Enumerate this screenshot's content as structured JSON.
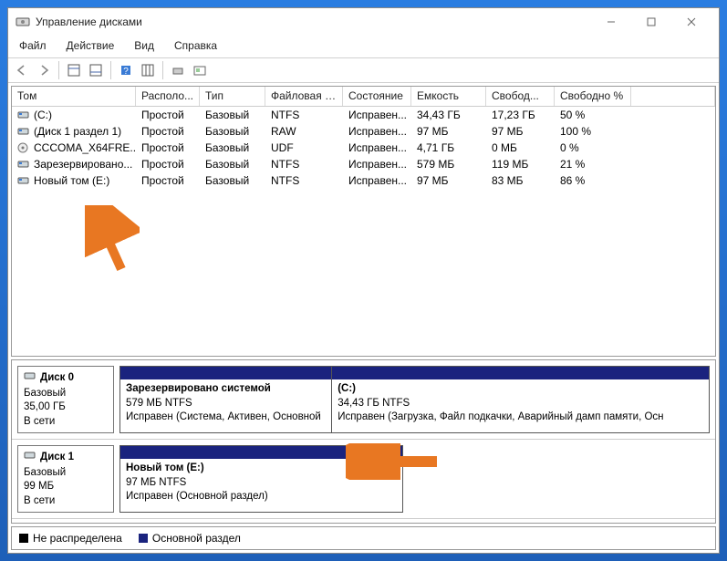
{
  "window": {
    "title": "Управление дисками"
  },
  "menu": {
    "file": "Файл",
    "action": "Действие",
    "view": "Вид",
    "help": "Справка"
  },
  "columns": {
    "c0": "Том",
    "c1": "Располо...",
    "c2": "Тип",
    "c3": "Файловая с...",
    "c4": "Состояние",
    "c5": "Емкость",
    "c6": "Свобод...",
    "c7": "Свободно %"
  },
  "volumes": [
    {
      "name": "(C:)",
      "layout": "Простой",
      "type": "Базовый",
      "fs": "NTFS",
      "status": "Исправен...",
      "capacity": "34,43 ГБ",
      "free": "17,23 ГБ",
      "freepct": "50 %",
      "icon": "drive"
    },
    {
      "name": "(Диск 1 раздел 1)",
      "layout": "Простой",
      "type": "Базовый",
      "fs": "RAW",
      "status": "Исправен...",
      "capacity": "97 МБ",
      "free": "97 МБ",
      "freepct": "100 %",
      "icon": "drive"
    },
    {
      "name": "CCCOMA_X64FRE...",
      "layout": "Простой",
      "type": "Базовый",
      "fs": "UDF",
      "status": "Исправен...",
      "capacity": "4,71 ГБ",
      "free": "0 МБ",
      "freepct": "0 %",
      "icon": "cd"
    },
    {
      "name": "Зарезервировано...",
      "layout": "Простой",
      "type": "Базовый",
      "fs": "NTFS",
      "status": "Исправен...",
      "capacity": "579 МБ",
      "free": "119 МБ",
      "freepct": "21 %",
      "icon": "drive"
    },
    {
      "name": "Новый том (E:)",
      "layout": "Простой",
      "type": "Базовый",
      "fs": "NTFS",
      "status": "Исправен...",
      "capacity": "97 МБ",
      "free": "83 МБ",
      "freepct": "86 %",
      "icon": "drive"
    }
  ],
  "disks": [
    {
      "name": "Диск 0",
      "type": "Базовый",
      "size": "35,00 ГБ",
      "status": "В сети",
      "parts": [
        {
          "title": "Зарезервировано системой",
          "line2": "579 МБ NTFS",
          "line3": "Исправен (Система, Активен, Основной",
          "widthpct": 36
        },
        {
          "title": " (C:)",
          "line2": "34,43 ГБ NTFS",
          "line3": "Исправен (Загрузка, Файл подкачки, Аварийный дамп памяти, Осн",
          "widthpct": 64
        }
      ]
    },
    {
      "name": "Диск 1",
      "type": "Базовый",
      "size": "99 МБ",
      "status": "В сети",
      "parts": [
        {
          "title": "Новый том  (E:)",
          "line2": "97 МБ NTFS",
          "line3": "Исправен (Основной раздел)",
          "widthpct": 41
        }
      ],
      "widthOverride": 41
    }
  ],
  "legend": {
    "unallocated": "Не распределена",
    "primary": "Основной раздел"
  }
}
